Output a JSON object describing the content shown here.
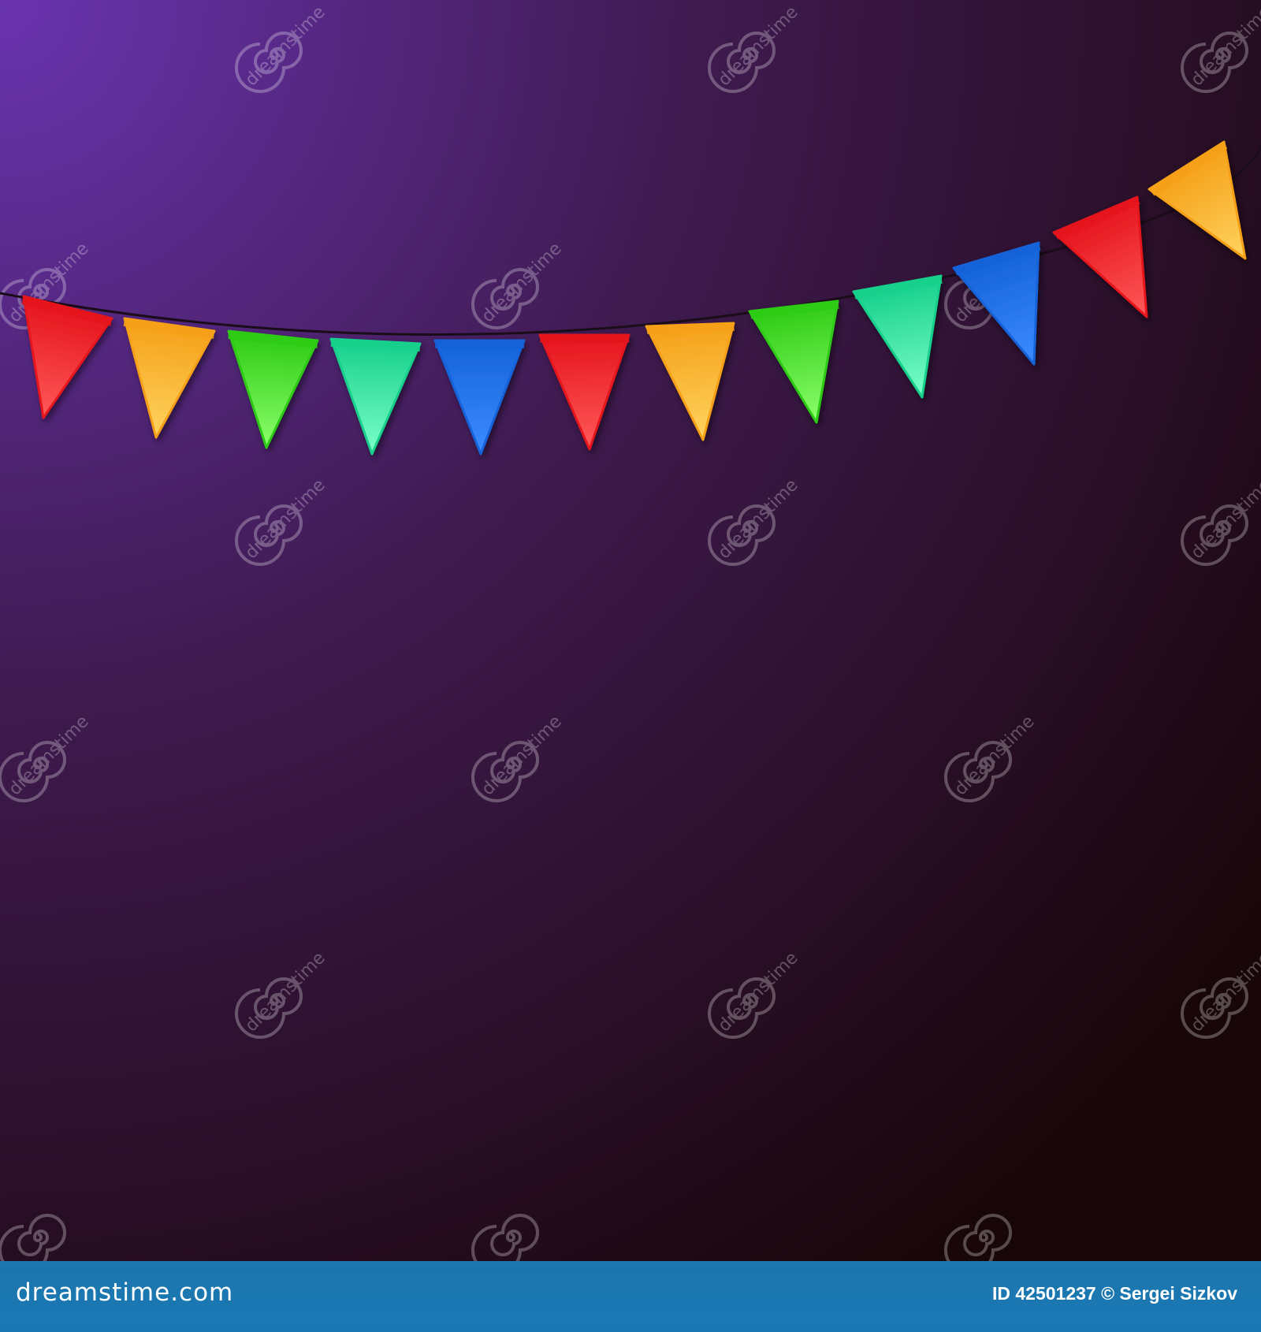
{
  "scene": {
    "description_colors": {
      "background_top_left": "#6a34b0",
      "background_mid": "#3e1a4e",
      "background_bottom_right": "#180608",
      "string": "#1a0c18"
    },
    "flag_colors": [
      "red",
      "orange",
      "green",
      "teal",
      "blue",
      "red",
      "orange",
      "green",
      "teal",
      "blue",
      "red",
      "orange"
    ],
    "palette": {
      "red": [
        "#ff5a5a",
        "#e5141c"
      ],
      "orange": [
        "#ffd460",
        "#f5a018"
      ],
      "green": [
        "#8cff6c",
        "#2ecb14"
      ],
      "teal": [
        "#7cffc8",
        "#16d08c"
      ],
      "blue": [
        "#3c8cff",
        "#1462d8"
      ]
    },
    "watermark": {
      "text": "dreamstime",
      "icon": "dreamstime-spiral-icon"
    }
  },
  "footer": {
    "logo_text": "dreamstime.com",
    "credit_text": "ID 42501237 © Sergei Sizkov"
  }
}
